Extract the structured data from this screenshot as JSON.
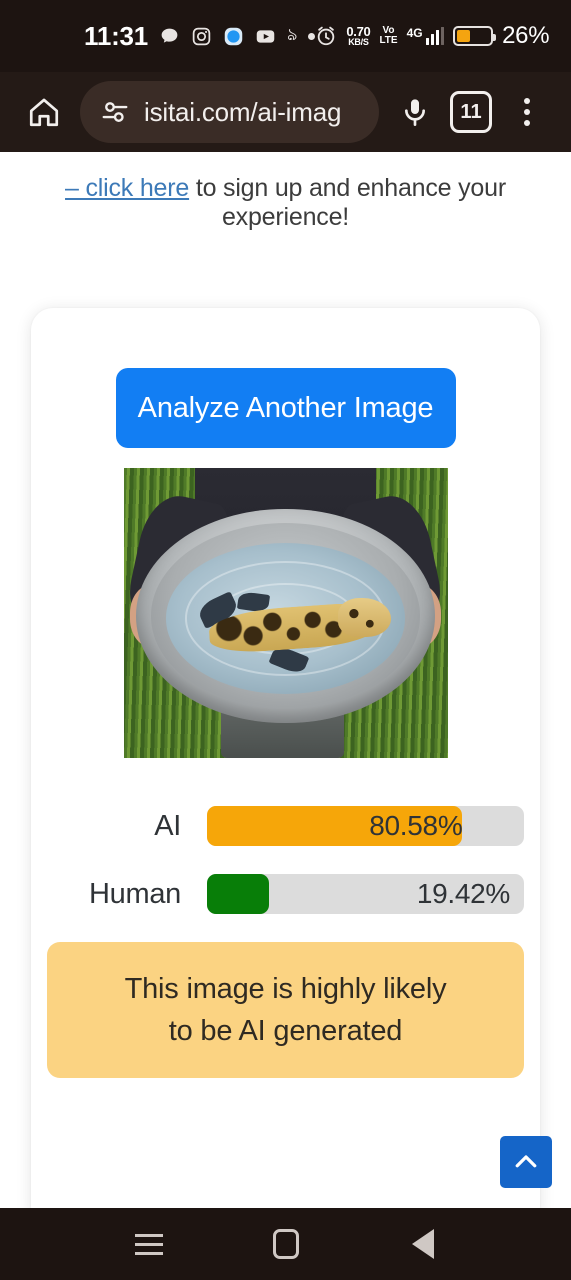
{
  "status_bar": {
    "clock": "11:31",
    "icons": [
      "chat-bubble-icon",
      "instagram-icon",
      "app-icon",
      "youtube-icon",
      "bengali-glyph-icon",
      "dot-icon"
    ],
    "net_speed_value": "0.70",
    "net_speed_unit": "KB/S",
    "volte_top": "Vo",
    "volte_bottom": "LTE",
    "network_type": "4G",
    "battery_percent": "26%",
    "battery_level": 26,
    "battery_color": "#f4a410"
  },
  "toolbar": {
    "home_icon": "home-icon",
    "site_info_icon": "tune-icon",
    "url": "isitai.com/ai-imag",
    "mic_icon": "microphone-icon",
    "tab_count": "11",
    "menu_icon": "kebab-menu-icon"
  },
  "page": {
    "signup_link": "– click here",
    "signup_rest": " to sign up and enhance your experience!",
    "link_color": "#3d7ab8"
  },
  "card": {
    "analyze_button": "Analyze Another Image",
    "analyze_button_color": "#127ef3",
    "image_alt": "leopard-patterned fish in metal basin held by person in grass field"
  },
  "results": {
    "rows": [
      {
        "label": "AI",
        "value": "80.58%",
        "percent": 80.58,
        "color": "#f6a609",
        "value_position": "fill-end"
      },
      {
        "label": "Human",
        "value": "19.42%",
        "percent": 19.42,
        "color": "#087e08",
        "value_position": "track-end"
      }
    ],
    "track_color": "#dcdcdc"
  },
  "verdict": {
    "line1": "This image is highly likely",
    "line2": "to be AI generated",
    "background": "#fbd382"
  },
  "scroll_top": {
    "icon": "chevron-up-icon",
    "color": "#1565c8"
  },
  "nav_bar": {
    "recents": "recents-icon",
    "home": "home-square-icon",
    "back": "back-triangle-icon"
  }
}
